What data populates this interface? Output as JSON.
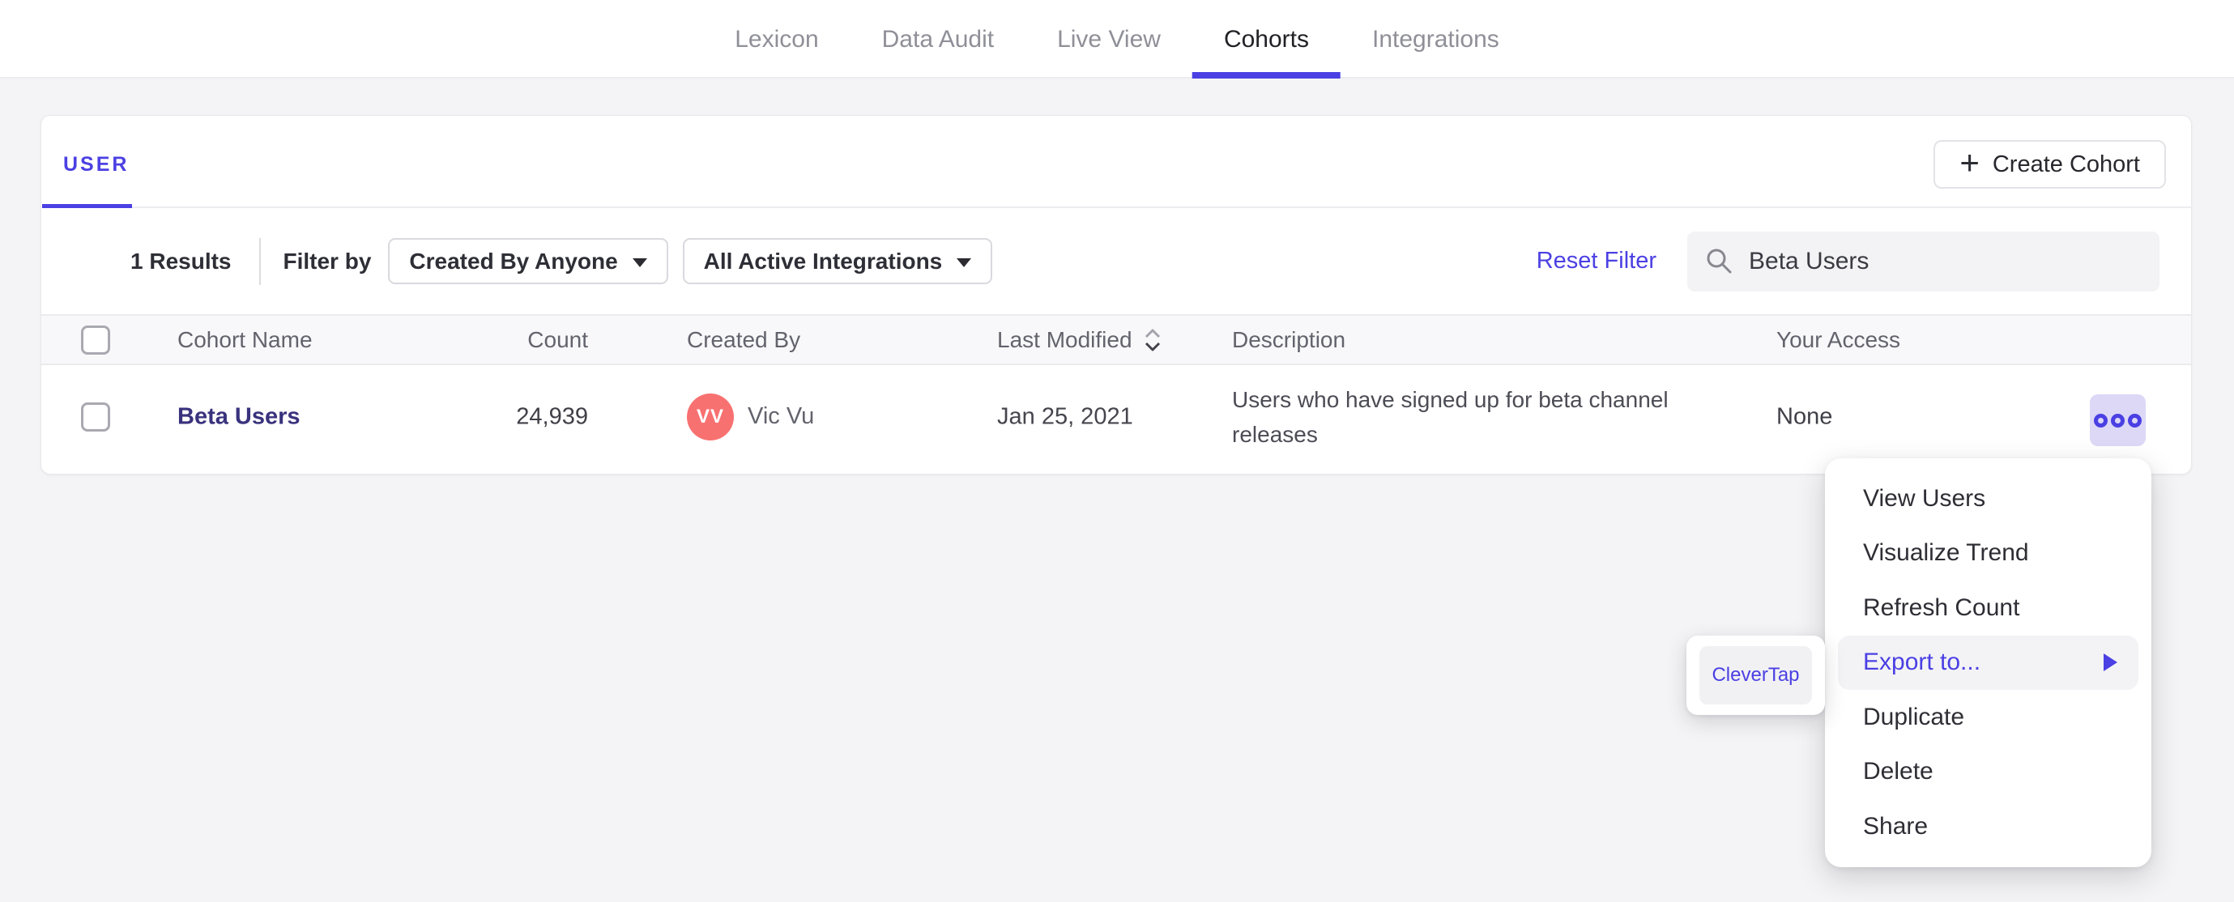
{
  "nav": {
    "tabs": [
      {
        "label": "Lexicon",
        "active": false
      },
      {
        "label": "Data Audit",
        "active": false
      },
      {
        "label": "Live View",
        "active": false
      },
      {
        "label": "Cohorts",
        "active": true
      },
      {
        "label": "Integrations",
        "active": false
      }
    ]
  },
  "panel": {
    "tabs": [
      {
        "label": "USER",
        "active": true
      }
    ],
    "create_cohort_button": {
      "icon": "plus",
      "label": "Create Cohort"
    },
    "filter_bar": {
      "results_count": "1 Results",
      "filter_by_label": "Filter by",
      "dropdowns": [
        {
          "label": "Created By Anyone"
        },
        {
          "label": "All Active Integrations"
        }
      ],
      "reset_filter_label": "Reset Filter",
      "search": {
        "icon": "magnifier",
        "value": "Beta Users"
      }
    },
    "table": {
      "columns": [
        {
          "label": "Cohort Name"
        },
        {
          "label": "Count"
        },
        {
          "label": "Created By"
        },
        {
          "label": "Last Modified",
          "sorted": true
        },
        {
          "label": "Description"
        },
        {
          "label": "Your Access"
        }
      ],
      "rows": [
        {
          "name": "Beta Users",
          "count": "24,939",
          "created_by": {
            "initials": "VV",
            "name": "Vic Vu"
          },
          "last_modified": "Jan 25, 2021",
          "description": "Users who have signed up for beta channel releases",
          "your_access": "None"
        }
      ]
    }
  },
  "context_menu": {
    "items": [
      {
        "label": "View Users",
        "highlighted": false
      },
      {
        "label": "Visualize Trend",
        "highlighted": false
      },
      {
        "label": "Refresh Count",
        "highlighted": false
      },
      {
        "label": "Export to...",
        "highlighted": true,
        "has_submenu": true
      },
      {
        "label": "Duplicate",
        "highlighted": false
      },
      {
        "label": "Delete",
        "highlighted": false
      },
      {
        "label": "Share",
        "highlighted": false
      }
    ],
    "submenu": {
      "items": [
        {
          "label": "CleverTap",
          "highlighted": true
        }
      ]
    }
  },
  "colors": {
    "accent": "#4b40e3",
    "cohort_link": "#39327d",
    "avatar_bg": "#f87171",
    "page_bg": "#f4f4f6",
    "menu_highlight_bg": "#f3f3f6"
  }
}
